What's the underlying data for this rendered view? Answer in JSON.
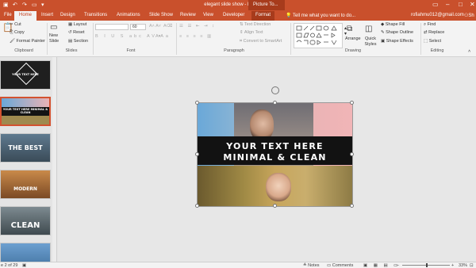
{
  "window": {
    "title": "elegant slide show - PowerPoint",
    "contextual_tab": "Picture To...",
    "user": "rofiahmu012@gmail.com",
    "share": "Sh",
    "tellme": "Tell me what you want to do..."
  },
  "tabs": [
    "File",
    "Home",
    "Insert",
    "Design",
    "Transitions",
    "Animations",
    "Slide Show",
    "Review",
    "View",
    "Developer",
    "Format"
  ],
  "ribbon": {
    "clipboard": {
      "label": "Clipboard",
      "cut": "Cut",
      "copy": "Copy",
      "format_painter": "Format Painter"
    },
    "slides": {
      "label": "Slides",
      "new_slide": "New Slide",
      "layout": "Layout",
      "reset": "Reset",
      "section": "Section"
    },
    "font": {
      "label": "Font",
      "size": "60"
    },
    "paragraph": {
      "label": "Paragraph",
      "text_direction": "Text Direction",
      "align_text": "Align Text",
      "smartart": "Convert to SmartArt"
    },
    "drawing": {
      "label": "Drawing",
      "arrange": "Arrange",
      "quick_styles": "Quick Styles",
      "shape_fill": "Shape Fill",
      "shape_outline": "Shape Outline",
      "shape_effects": "Shape Effects"
    },
    "editing": {
      "label": "Editing",
      "find": "Find",
      "replace": "Replace",
      "select": "Select"
    }
  },
  "thumbnails": [
    {
      "title": "YOUR TEXT HERE"
    },
    {
      "title": "YOUR TEXT HERE MINIMAL & CLEAN"
    },
    {
      "title": "THE BEST"
    },
    {
      "title": "MODERN"
    },
    {
      "title": "CLEAN"
    },
    {
      "title": ""
    }
  ],
  "slide": {
    "line1": "YOUR TEXT HERE",
    "line2": "MINIMAL & CLEAN"
  },
  "status": {
    "slide_of": "e 2 of 29",
    "notes": "Notes",
    "comments": "Comments",
    "zoom": "33%"
  },
  "colors": {
    "accent": "#c9502c",
    "selected_thumb": "#d35230"
  }
}
